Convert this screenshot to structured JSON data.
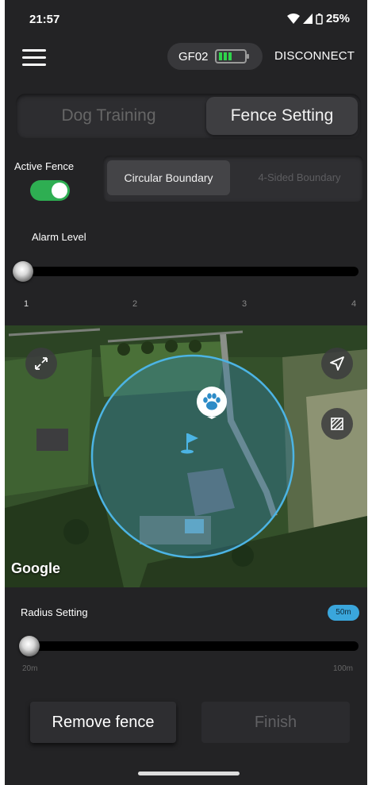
{
  "status_bar": {
    "time": "21:57",
    "battery": "25%"
  },
  "header": {
    "device_name": "GF02",
    "disconnect_label": "DISCONNECT"
  },
  "mode_tabs": [
    {
      "label": "Dog Training",
      "selected": false
    },
    {
      "label": "Fence Setting",
      "selected": true
    }
  ],
  "active_fence": {
    "label": "Active Fence",
    "on": true
  },
  "boundary_tabs": [
    {
      "label": "Circular Boundary",
      "selected": true
    },
    {
      "label": "4-Sided Boundary",
      "selected": false
    }
  ],
  "alarm": {
    "label": "Alarm Level",
    "ticks": [
      "1",
      "2",
      "3",
      "4"
    ],
    "value": 1
  },
  "map": {
    "attribution": "Google",
    "icons": [
      "expand-icon",
      "navigation-arrow-icon",
      "layer-icon",
      "paw-icon",
      "flag-icon"
    ]
  },
  "radius": {
    "label": "Radius Setting",
    "value_badge": "50m",
    "min_label": "20m",
    "max_label": "100m",
    "value_m": 20
  },
  "buttons": {
    "remove_label": "Remove fence",
    "finish_label": "Finish"
  },
  "colors": {
    "accent_green": "#2eae52",
    "fence_blue": "#3aa6dc",
    "background": "#232325"
  }
}
